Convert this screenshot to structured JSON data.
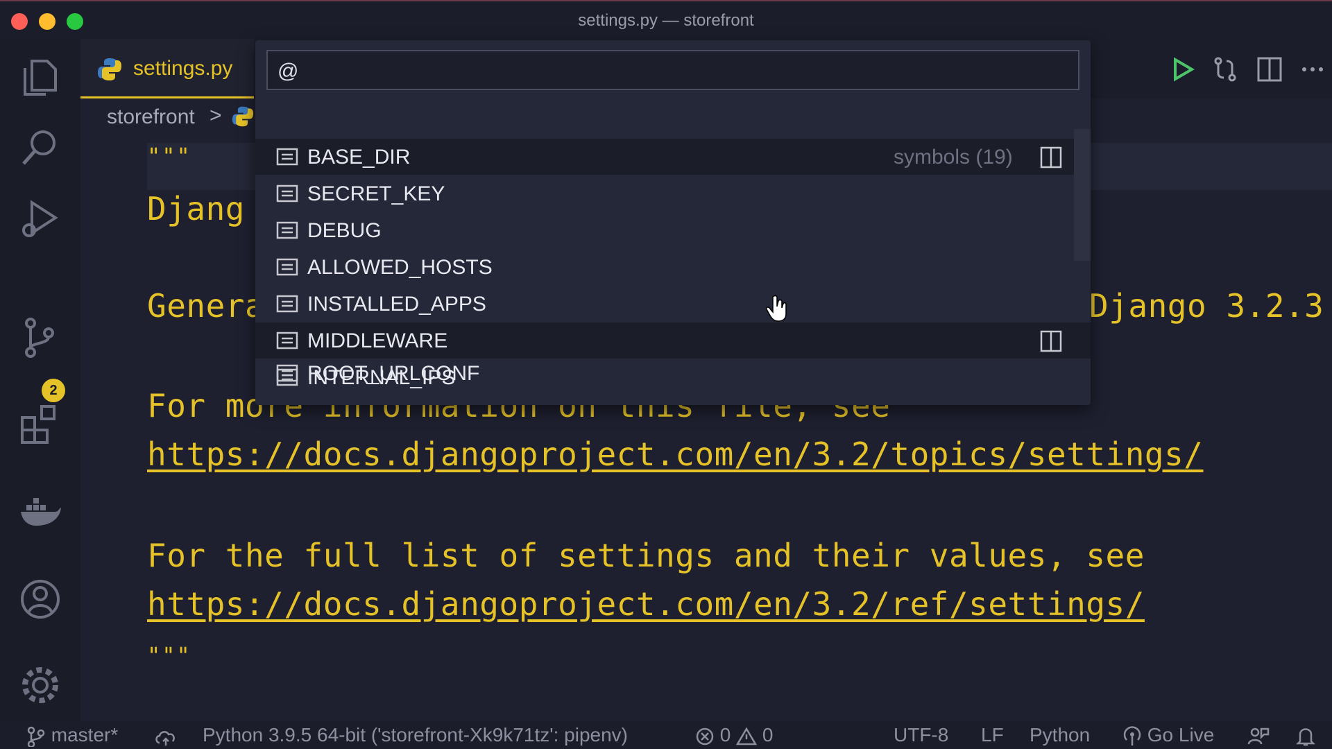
{
  "window": {
    "title": "settings.py — storefront"
  },
  "activity_bar": {
    "source_control_badge": "2"
  },
  "tabs": [
    {
      "label": "settings.py"
    }
  ],
  "breadcrumb": {
    "folder": "storefront",
    "separator": ">"
  },
  "editor": {
    "lines": [
      {
        "text": "\"\"\""
      },
      {
        "text": "Djang"
      },
      {
        "text": "Genera"
      },
      {
        "text": "Django 3.2.3"
      },
      {
        "text": "For more information on this file, see"
      },
      {
        "text": "https://docs.djangoproject.com/en/3.2/topics/settings/"
      },
      {
        "text": "For the full list of settings and their values, see"
      },
      {
        "text": "https://docs.djangoproject.com/en/3.2/ref/settings/"
      },
      {
        "text": "\"\"\""
      }
    ]
  },
  "quick_open": {
    "input_value": "@",
    "meta": "symbols (19)",
    "items": [
      {
        "label": "BASE_DIR"
      },
      {
        "label": "SECRET_KEY"
      },
      {
        "label": "DEBUG"
      },
      {
        "label": "ALLOWED_HOSTS"
      },
      {
        "label": "INSTALLED_APPS"
      },
      {
        "label": "MIDDLEWARE"
      },
      {
        "label": "INTERNAL_IPS"
      },
      {
        "label": "ROOT_URLCONF"
      }
    ]
  },
  "status_bar": {
    "branch": "master*",
    "interpreter": "Python 3.9.5 64-bit ('storefront-Xk9k71tz': pipenv)",
    "errors": "0",
    "warnings": "0",
    "encoding": "UTF-8",
    "eol": "LF",
    "language": "Python",
    "live": "Go Live"
  },
  "colors": {
    "accent": "#e6c229",
    "background": "#1e2030",
    "widget": "#252838"
  }
}
